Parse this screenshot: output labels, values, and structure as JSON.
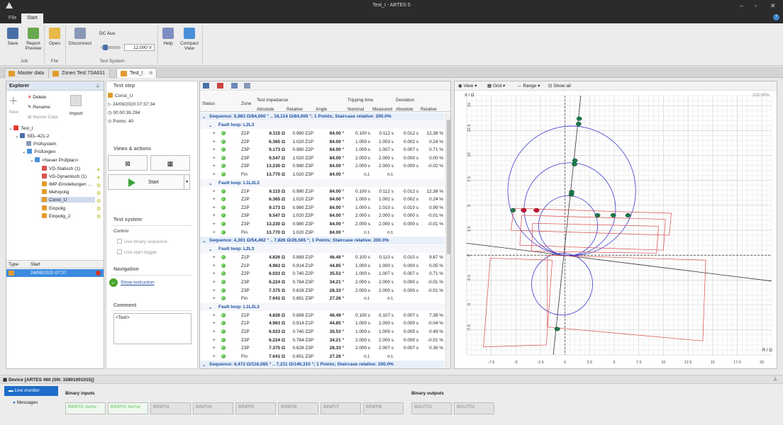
{
  "window": {
    "title": "Test_I - ARTES 5"
  },
  "menu": {
    "tabs": [
      "File",
      "Start"
    ]
  },
  "ribbon": {
    "save": "Save",
    "report_preview": "Report\nPreview",
    "open": "Open",
    "disconnect": "Disconnect",
    "dc_aux": "DC Aux.",
    "dc_voltage": "12.000 V",
    "help": "Help",
    "compact_view": "Compact\nView",
    "groups": {
      "job": "Job",
      "file": "File",
      "test_system": "Test System"
    }
  },
  "doc_tabs": [
    "Master data",
    "Zones Test 7SA631",
    "Test_I"
  ],
  "explorer": {
    "title": "Explorer",
    "actions": {
      "new": "New",
      "delete": "Delete",
      "rename": "Rename",
      "master_data": "Master Data",
      "import": "Import"
    },
    "tree": [
      "Test_I",
      "SEL-421-2",
      "Prüfsystem",
      "Prüfungen",
      "<Neuer Prüfplan>",
      "VD-Statisch (1)",
      "VD-Dynamisch (1)",
      "IMP-Einstellungen ...",
      "Mehrpolig",
      "Const_U",
      "Einpolig",
      "Einpolig_2"
    ],
    "list_headers": {
      "type": "Type",
      "start": "Start"
    },
    "list_rows": [
      {
        "start": "24/09/2020 07:37"
      }
    ]
  },
  "test_step": {
    "header": "Test step",
    "name": "Const_U",
    "date": "24/09/2020 07:37:34",
    "duration": "00:00:39.294",
    "points": "Points: 40",
    "views_actions": "Views & actions",
    "start": "Start",
    "test_system": "Test system",
    "control": "Control",
    "use_binary_sequence": "Use binary sequence",
    "use_start_trigger": "Use start trigger",
    "navigation": "Navigation",
    "show_instruction": "Show instruction",
    "comment": "Comment",
    "comment_text": "<Text>"
  },
  "table": {
    "headers": {
      "status": "Status",
      "zone": "Zone",
      "test_impedance": "Test impedance",
      "absolute": "Absolute",
      "relative": "Relative",
      "angle": "Angle",
      "tripping_time": "Tripping time",
      "nominal": "Nominal",
      "measured": "Measured",
      "deviation": "Deviation",
      "dev_absolute": "Absolute",
      "dev_relative": "Relative"
    },
    "sequences": [
      {
        "title": "Sequence: 5,983 Ω/84,000 ° .. 16,114 Ω/84,000 °; 1 Points; Staircase relative: 200.0%",
        "loops": [
          {
            "title": "Fault loop: L2L3",
            "rows": [
              [
                "Z1P",
                "6.115 Ω",
                "0.980 Z1P",
                "84.00 °",
                "0.100 s",
                "0.112 s",
                "0.012 s",
                "12.38 %"
              ],
              [
                "Z2P",
                "6.365 Ω",
                "1.020 Z1P",
                "84.00 °",
                "1.000 s",
                "1.003 s",
                "0.002 s",
                "0.24 %"
              ],
              [
                "Z3P",
                "9.173 Ω",
                "0.980 Z2P",
                "84.00 °",
                "1.000 s",
                "1.007 s",
                "0.007 s",
                "0.71 %"
              ],
              [
                "Z3P",
                "9.547 Ω",
                "1.020 Z2P",
                "84.00 °",
                "2.000 s",
                "2.000 s",
                "0.000 s",
                "0.00 %"
              ],
              [
                "Z3P",
                "13.230 Ω",
                "0.980 Z3P",
                "84.00 °",
                "2.000 s",
                "2.000 s",
                "0.000 s",
                "-0.02 %"
              ],
              [
                "Fin",
                "13.770 Ω",
                "1.020 Z3P",
                "84.00 °",
                "n.t.",
                "n.t.",
                "",
                ""
              ]
            ]
          },
          {
            "title": "Fault loop: L1L2L3",
            "rows": [
              [
                "Z1P",
                "6.115 Ω",
                "0.980 Z1P",
                "84.00 °",
                "0.100 s",
                "0.112 s",
                "0.012 s",
                "12.38 %"
              ],
              [
                "Z2P",
                "6.365 Ω",
                "1.020 Z1P",
                "84.00 °",
                "1.000 s",
                "1.002 s",
                "0.002 s",
                "0.24 %"
              ],
              [
                "Z2P",
                "9.173 Ω",
                "0.980 Z2P",
                "84.00 °",
                "1.000 s",
                "1.010 s",
                "0.010 s",
                "0.99 %"
              ],
              [
                "Z3P",
                "9.547 Ω",
                "1.020 Z2P",
                "84.00 °",
                "2.000 s",
                "2.000 s",
                "0.000 s",
                "-0.01 %"
              ],
              [
                "Z3P",
                "13.230 Ω",
                "0.980 Z3P",
                "84.00 °",
                "2.000 s",
                "2.000 s",
                "0.000 s",
                "-0.01 %"
              ],
              [
                "Fin",
                "13.770 Ω",
                "1.020 Z3P",
                "84.00 °",
                "n.t.",
                "n.t.",
                "",
                ""
              ]
            ]
          }
        ]
      },
      {
        "title": "Sequence: 4,301 Ω/54,462 ° .. 7,826 Ω/26,565 °; 1 Points; Staircase relative: 200.0%",
        "loops": [
          {
            "title": "Fault loop: L2L3",
            "rows": [
              [
                "Z1P",
                "4.826 Ω",
                "0.889 Z1P",
                "46.49 °",
                "0.100 s",
                "0.110 s",
                "0.010 s",
                "9.87 %"
              ],
              [
                "Z1P",
                "4.963 Ω",
                "0.914 Z1P",
                "44.85 °",
                "1.000 s",
                "1.000 s",
                "0.000 s",
                "0.05 %"
              ],
              [
                "Z2P",
                "6.023 Ω",
                "0.740 Z2P",
                "35.53 °",
                "1.000 s",
                "1.007 s",
                "0.007 s",
                "0.71 %"
              ],
              [
                "Z3P",
                "6.224 Ω",
                "0.764 Z3P",
                "34.21 °",
                "2.000 s",
                "2.000 s",
                "0.000 s",
                "-0.01 %"
              ],
              [
                "Z3P",
                "7.375 Ω",
                "0.628 Z3P",
                "28.33 °",
                "2.000 s",
                "2.000 s",
                "0.000 s",
                "-0.01 %"
              ],
              [
                "Fin",
                "7.641 Ω",
                "0.651 Z3P",
                "27.26 °",
                "n.t.",
                "n.t.",
                "",
                ""
              ]
            ]
          },
          {
            "title": "Fault loop: L1L2L3",
            "rows": [
              [
                "Z1P",
                "4.826 Ω",
                "0.889 Z1P",
                "46.49 °",
                "0.100 s",
                "0.107 s",
                "0.007 s",
                "7.38 %"
              ],
              [
                "Z1P",
                "4.963 Ω",
                "0.914 Z1P",
                "44.85 °",
                "1.000 s",
                "1.000 s",
                "0.000 s",
                "-0.04 %"
              ],
              [
                "Z2P",
                "6.023 Ω",
                "0.740 Z2P",
                "35.53 °",
                "1.000 s",
                "1.005 s",
                "0.005 s",
                "0.49 %"
              ],
              [
                "Z3P",
                "6.224 Ω",
                "0.764 Z3P",
                "34.21 °",
                "2.000 s",
                "2.000 s",
                "0.000 s",
                "-0.01 %"
              ],
              [
                "Z3P",
                "7.375 Ω",
                "0.628 Z3P",
                "28.33 °",
                "2.000 s",
                "2.007 s",
                "0.007 s",
                "0.36 %"
              ],
              [
                "Fin",
                "7.641 Ω",
                "0.651 Z3P",
                "27.26 °",
                "n.t.",
                "n.t.",
                "",
                ""
              ]
            ]
          }
        ]
      }
    ],
    "cut_row": "Sequence: 4,472 Ω/116,565 ° .. 7,211 Ω/146,310 °; 1 Points; Staircase relative: 200.0%"
  },
  "chart_toolbar": {
    "view": "View",
    "grid": "Grid",
    "range": "Range",
    "show_all": "Show all"
  },
  "chart": {
    "x_axis_label": "R / Ω",
    "y_axis_label": "X / Ω",
    "zoom": "100.00%",
    "x_ticks": [
      "-7.5",
      "-5",
      "-2.5",
      "0",
      "2.5",
      "5",
      "7.5",
      "10",
      "12.5",
      "15",
      "17.5",
      "20"
    ],
    "y_ticks": [
      "15",
      "12.5",
      "10",
      "7.5",
      "5",
      "2.5",
      "0",
      "-2.5",
      "-5",
      "-7.5"
    ]
  },
  "chart_data": {
    "type": "scatter",
    "xlabel": "R / Ω",
    "ylabel": "X / Ω",
    "xlim": [
      -10,
      21
    ],
    "ylim": [
      -10,
      16
    ],
    "circles": [
      {
        "cx": 0.68,
        "cy": 6.45,
        "r": 6.5
      },
      {
        "cx": 0.49,
        "cy": 4.62,
        "r": 4.65
      },
      {
        "cx": 0.31,
        "cy": 2.95,
        "r": 3.0
      },
      {
        "cx": -0.3,
        "cy": -2.9,
        "r": 3.1
      }
    ],
    "line_points": [
      {
        "x": 0.64,
        "y": 6.08
      },
      {
        "x": 0.67,
        "y": 6.33
      },
      {
        "x": 0.96,
        "y": 9.12
      },
      {
        "x": 1.0,
        "y": 9.49
      },
      {
        "x": 1.38,
        "y": 13.16
      },
      {
        "x": 1.44,
        "y": 13.69
      },
      {
        "x": -5.3,
        "y": 4.5
      },
      {
        "x": -4.2,
        "y": 4.5
      },
      {
        "x": -2.9,
        "y": 4.5
      },
      {
        "x": 3.3,
        "y": 4.0
      },
      {
        "x": 4.9,
        "y": 4.0
      },
      {
        "x": 6.4,
        "y": 4.0
      },
      {
        "x": -0.8,
        "y": -7.4
      }
    ],
    "red_points": [
      {
        "x": -4.2,
        "y": 4.5
      },
      {
        "x": -2.9,
        "y": 4.5
      }
    ]
  },
  "device": {
    "title": "Device [ARTES 460 (SN: 32801001015)]",
    "live_monitor": "Live monitor",
    "messages": "Messages",
    "binary_inputs": "Binary inputs",
    "binary_outputs": "Binary outputs",
    "inputs": [
      {
        "name": "BINP01",
        "state": "RelOn"
      },
      {
        "name": "BINP02",
        "state": "RelTrip"
      },
      {
        "name": "BINP03",
        "state": ""
      },
      {
        "name": "BINP04",
        "state": ""
      },
      {
        "name": "BINP05",
        "state": ""
      },
      {
        "name": "BINP06",
        "state": ""
      },
      {
        "name": "BINP07",
        "state": ""
      },
      {
        "name": "BINP08",
        "state": ""
      }
    ],
    "outputs": [
      {
        "name": "BOUT01"
      },
      {
        "name": "BOUT02"
      }
    ]
  }
}
